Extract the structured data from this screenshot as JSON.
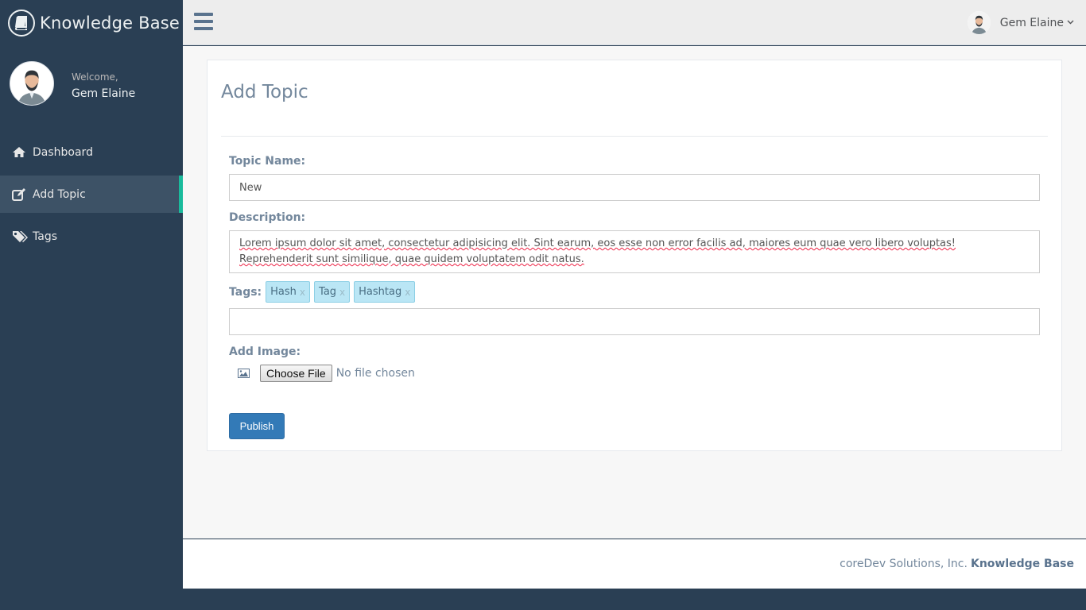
{
  "brand": {
    "title": "Knowledge Base",
    "icon": "book-icon"
  },
  "profile": {
    "welcome": "Welcome,",
    "name": "Gem Elaine"
  },
  "sidebar": {
    "items": [
      {
        "label": "Dashboard",
        "icon": "home-icon"
      },
      {
        "label": "Add Topic",
        "icon": "edit-icon",
        "active": true
      },
      {
        "label": "Tags",
        "icon": "tags-icon"
      }
    ]
  },
  "topbar": {
    "user_name": "Gem Elaine"
  },
  "form": {
    "title": "Add Topic",
    "topic_label": "Topic Name:",
    "topic_value": "New",
    "description_label": "Description:",
    "description_value": "Lorem ipsum dolor sit amet, consectetur adipisicing elit. Sint earum, eos esse non error facilis ad, maiores eum quae vero libero voluptas! Reprehenderit sunt similique, quae quidem voluptatem odit natus.",
    "tags_label": "Tags:",
    "tags": [
      "Hash",
      "Tag",
      "Hashtag"
    ],
    "tag_remove": "x",
    "tags_input_value": "",
    "image_label": "Add Image:",
    "file_button": "Choose File",
    "file_status": "No file chosen",
    "publish": "Publish"
  },
  "footer": {
    "company": "coreDev Solutions, Inc.",
    "brand": "Knowledge Base"
  },
  "colors": {
    "sidebar": "#2a3f54",
    "accent": "#1abb9c",
    "primary": "#337ab7",
    "tag_bg": "#bae6f5"
  }
}
